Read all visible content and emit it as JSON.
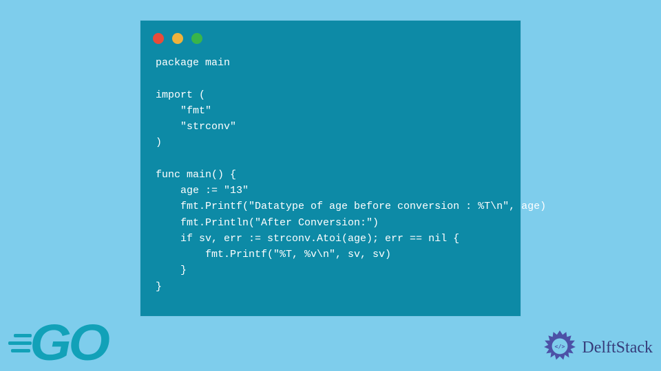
{
  "code": {
    "lines": [
      "package main",
      "",
      "import (",
      "    \"fmt\"",
      "    \"strconv\"",
      ")",
      "",
      "func main() {",
      "    age := \"13\"",
      "    fmt.Printf(\"Datatype of age before conversion : %T\\n\", age)",
      "    fmt.Println(\"After Conversion:\")",
      "    if sv, err := strconv.Atoi(age); err == nil {",
      "        fmt.Printf(\"%T, %v\\n\", sv, sv)",
      "    }",
      "}"
    ]
  },
  "logos": {
    "go": "GO",
    "delft": "DelftStack"
  },
  "colors": {
    "page_bg": "#7ecdec",
    "window_bg": "#0d8aa6",
    "code_text": "#ffffff",
    "go_logo": "#12a1b8",
    "delft_text": "#363c7a",
    "delft_icon": "#4c51a6"
  }
}
